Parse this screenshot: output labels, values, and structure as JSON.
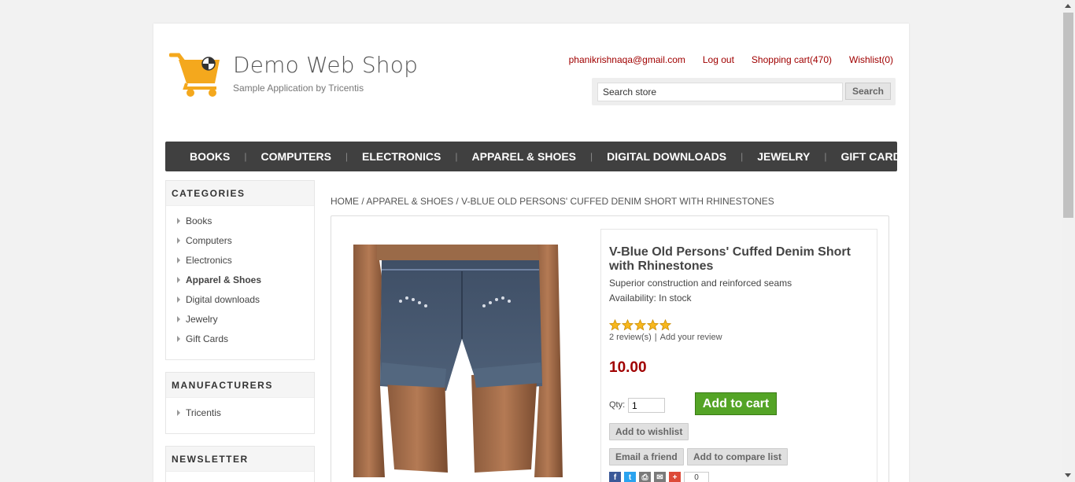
{
  "logo": {
    "title": "Demo Web Shop",
    "subtitle": "Sample Application by Tricentis",
    "icon": "shopping-cart-logo-icon",
    "accent": "#f4a81d"
  },
  "header_links": {
    "email": "phanikrishnaqa@gmail.com",
    "logout": "Log out",
    "cart": "Shopping cart(470)",
    "wishlist": "Wishlist(0)"
  },
  "search": {
    "value": "Search store",
    "button": "Search"
  },
  "nav": [
    "BOOKS",
    "COMPUTERS",
    "ELECTRONICS",
    "APPAREL & SHOES",
    "DIGITAL DOWNLOADS",
    "JEWELRY",
    "GIFT CARDS"
  ],
  "categories": {
    "title": "CATEGORIES",
    "items": [
      "Books",
      "Computers",
      "Electronics",
      "Apparel & Shoes",
      "Digital downloads",
      "Jewelry",
      "Gift Cards"
    ],
    "active": "Apparel & Shoes"
  },
  "manufacturers": {
    "title": "MANUFACTURERS",
    "items": [
      "Tricentis"
    ]
  },
  "newsletter": {
    "title": "NEWSLETTER"
  },
  "breadcrumb": {
    "home": "HOME",
    "category": "APPAREL & SHOES",
    "current": "V-BLUE OLD PERSONS' CUFFED DENIM SHORT WITH RHINESTONES",
    "sep": "/"
  },
  "product": {
    "name": "V-Blue Old Persons' Cuffed Denim Short with Rhinestones",
    "short_description": "Superior construction and reinforced seams",
    "availability": "Availability: In stock",
    "rating": 5,
    "reviews_link": "2 review(s)",
    "review_sep": "|",
    "add_review": "Add your review",
    "price": "10.00",
    "qty_label": "Qty:",
    "qty_value": "1",
    "add_to_cart": "Add to cart",
    "add_to_wishlist": "Add to wishlist",
    "email_friend": "Email a friend",
    "add_to_compare": "Add to compare list",
    "share_count": "0",
    "share_icons": [
      "facebook-icon",
      "twitter-icon",
      "print-icon",
      "email-icon",
      "plus-icon"
    ]
  },
  "colors": {
    "link_red": "#a00000",
    "nav_bg": "#404040",
    "cart_green": "#54a426"
  }
}
